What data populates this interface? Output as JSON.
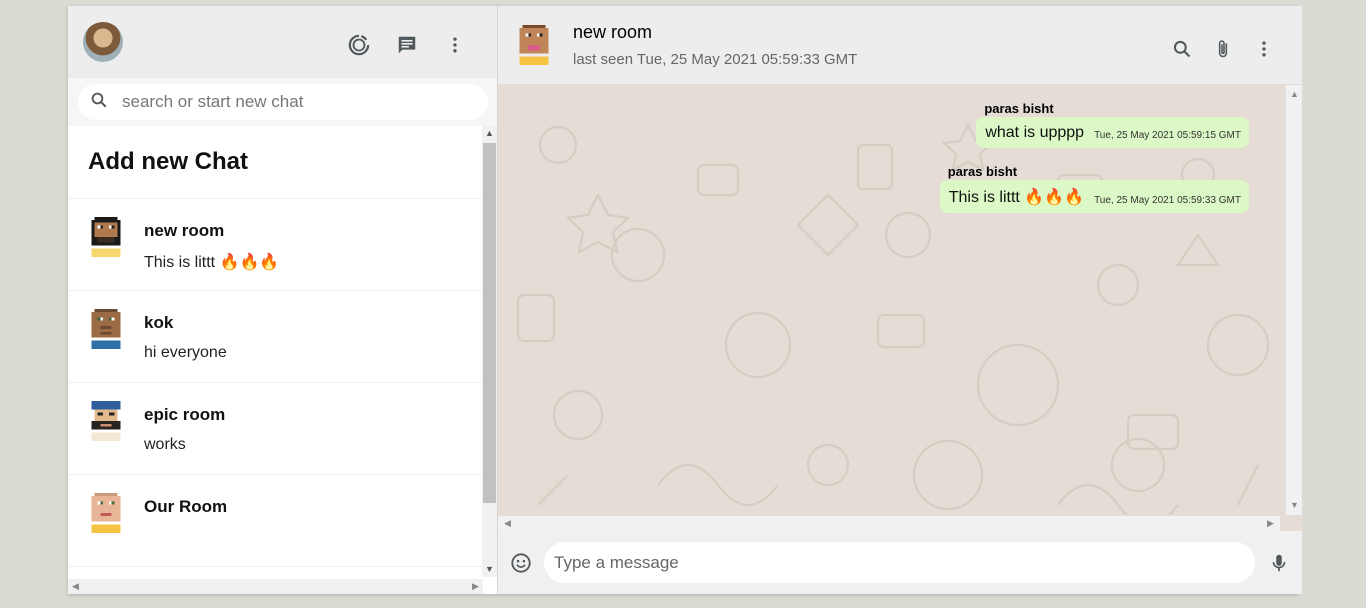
{
  "sidebar": {
    "header_icons": [
      "status-icon",
      "new-chat-icon",
      "more-vert-icon"
    ],
    "search_placeholder": "search or start new chat",
    "add_chat_label": "Add new Chat",
    "chats": [
      {
        "name": "new room",
        "last_message": "This is littt 🔥🔥🔥",
        "avatar_color": "#b07a4f"
      },
      {
        "name": "kok",
        "last_message": "hi everyone",
        "avatar_color": "#9a6b45"
      },
      {
        "name": "epic room",
        "last_message": "works",
        "avatar_color": "#e3b98e"
      },
      {
        "name": "Our Room",
        "last_message": "",
        "avatar_color": "#e8b597"
      }
    ]
  },
  "chat": {
    "room_name": "new room",
    "last_seen": "last seen Tue, 25 May 2021 05:59:33 GMT",
    "header_icons": [
      "search-icon",
      "attach-icon",
      "more-vert-icon"
    ],
    "messages": [
      {
        "sender": "paras bisht",
        "text": "what is upppp",
        "time": "Tue, 25 May 2021 05:59:15 GMT"
      },
      {
        "sender": "paras bisht",
        "text": "This is littt 🔥🔥🔥",
        "time": "Tue, 25 May 2021 05:59:33 GMT"
      }
    ],
    "input_placeholder": "Type a message",
    "bubble_color": "#dcf8c6",
    "background_color": "#e5ddd5"
  }
}
